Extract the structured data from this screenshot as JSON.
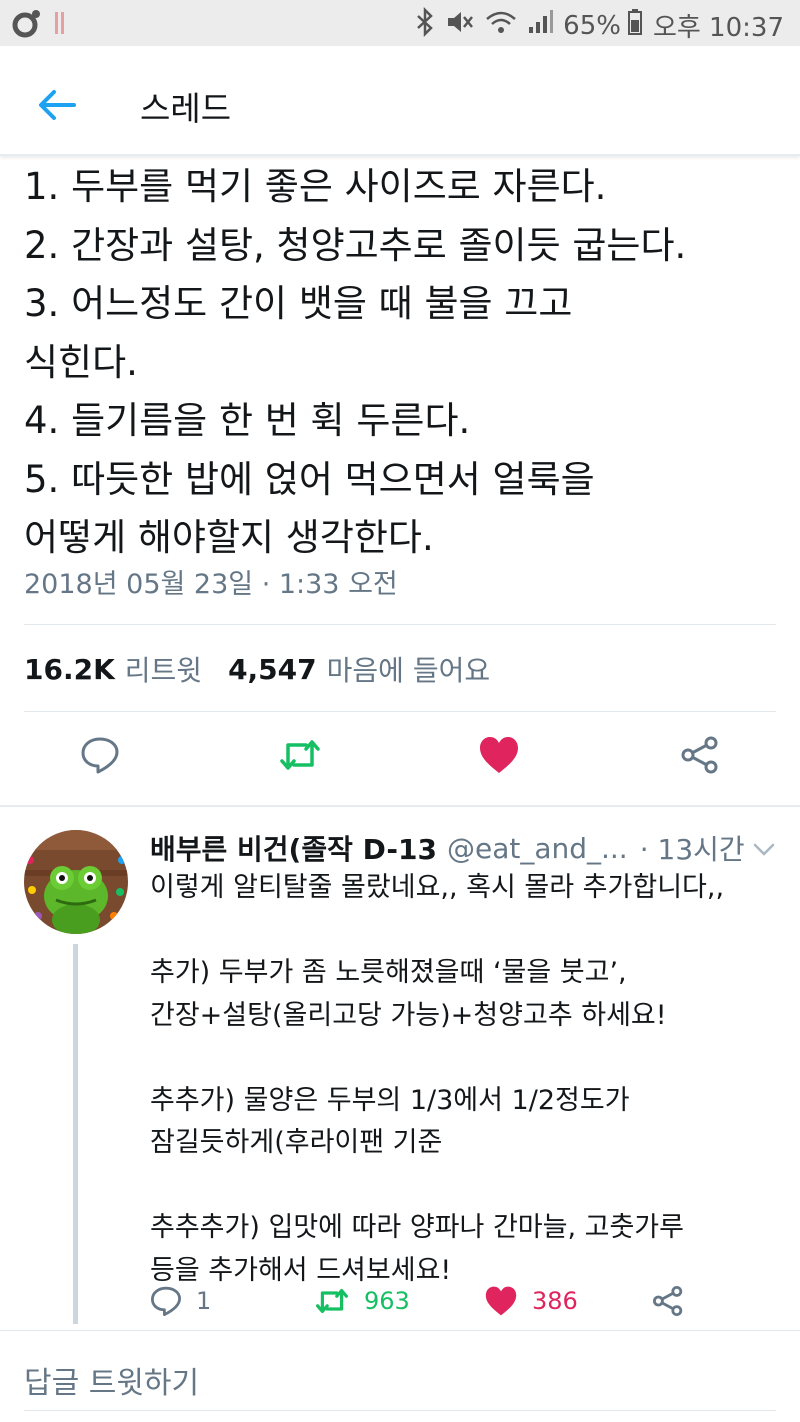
{
  "status_bar": {
    "battery": "65%",
    "time": "오후 10:37",
    "icons": [
      "notification-icon",
      "bluetooth-icon",
      "mute-icon",
      "wifi-icon",
      "signal-icon",
      "battery-icon"
    ]
  },
  "header": {
    "back_icon": "back-arrow-icon",
    "title": "스레드"
  },
  "tweet": {
    "lines": [
      "1. 두부를 먹기 좋은 사이즈로 자른다.",
      "2. 간장과 설탕, 청양고추로 졸이듯 굽는다.",
      "3. 어느정도 간이 뱃을 때 불을 끄고",
      "식힌다.",
      "4. 들기름을 한 번 휙 두른다.",
      "5. 따듯한 밥에 얹어 먹으면서 얼룩을",
      "어떻게 해야할지 생각한다."
    ],
    "timestamp": "2018년 05월 23일 · 1:33 오전",
    "retweets": "16.2K",
    "retweets_label": "리트윗",
    "likes": "4,547",
    "likes_label": "마음에 들어요",
    "liked": true
  },
  "reply": {
    "name": "배부른 비건(졸작 D-13",
    "handle": "@eat_and_...",
    "time": "· 13시간",
    "lines": [
      "이렇게 알티탈줄 몰랐네요,, 혹시 몰라 추가합니다,,",
      "",
      "추가) 두부가 좀 노릇해졌을때 ‘물을 붓고’,",
      "간장+설탕(올리고당 가능)+청양고추 하세요!",
      "",
      "추추가) 물양은 두부의 1/3에서 1/2정도가",
      "잠길듯하게(후라이팬 기준",
      "",
      "추추추가) 입맛에 따라 양파나 간마늘, 고춧가루",
      "등을 추가해서 드셔보세요!"
    ],
    "reply_count": "1",
    "retweet_count": "963",
    "like_count": "386"
  },
  "compose": {
    "placeholder": "답글 트윗하기"
  },
  "colors": {
    "accent": "#1da1f2",
    "retweet": "#17bf63",
    "like": "#e0245e",
    "muted": "#657786"
  }
}
